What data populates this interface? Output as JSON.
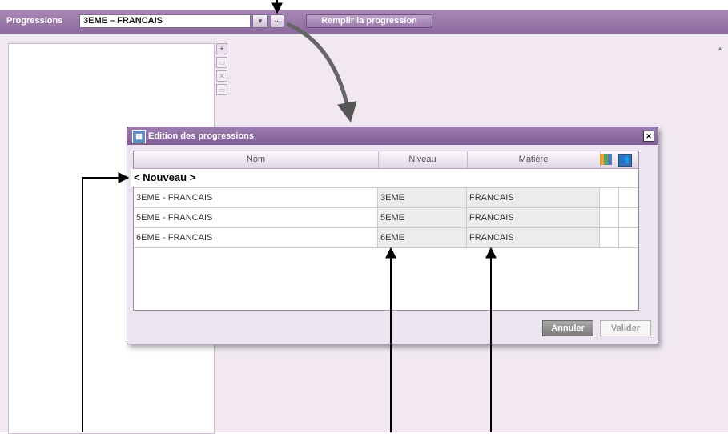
{
  "toolbar": {
    "label": "Progressions",
    "selected_progression": "3EME – FRANCAIS",
    "dropdown_glyph": "▼",
    "dots_label": "...",
    "fill_button": "Remplir la progression"
  },
  "side_tools": [
    "+",
    "▭",
    "✕",
    "▭"
  ],
  "dialog": {
    "title": "Edition des progressions",
    "close": "✕",
    "columns": {
      "nom": "Nom",
      "niveau": "Niveau",
      "matiere": "Matière"
    },
    "new_entry": "< Nouveau >",
    "rows": [
      {
        "nom": "3EME - FRANCAIS",
        "niveau": "3EME",
        "matiere": "FRANCAIS"
      },
      {
        "nom": "5EME - FRANCAIS",
        "niveau": "5EME",
        "matiere": "FRANCAIS"
      },
      {
        "nom": "6EME - FRANCAIS",
        "niveau": "6EME",
        "matiere": "FRANCAIS"
      }
    ],
    "cancel": "Annuler",
    "validate": "Valider"
  },
  "icons": [
    "chart-icon",
    "users-icon",
    "window-icon",
    "close-icon",
    "arrow-icon"
  ]
}
